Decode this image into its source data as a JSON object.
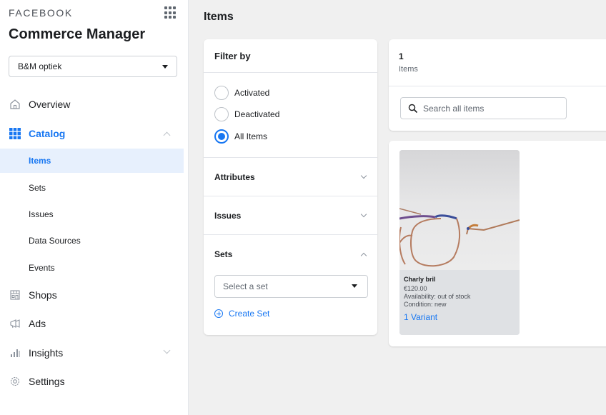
{
  "sidebar": {
    "brand": "FACEBOOK",
    "app_title": "Commerce Manager",
    "account": "B&M optiek",
    "nav": {
      "overview": "Overview",
      "catalog": "Catalog",
      "shops": "Shops",
      "ads": "Ads",
      "insights": "Insights",
      "settings": "Settings"
    },
    "catalog_sub": [
      "Items",
      "Sets",
      "Issues",
      "Data Sources",
      "Events"
    ]
  },
  "main": {
    "title": "Items",
    "filter": {
      "heading": "Filter by",
      "options": [
        "Activated",
        "Deactivated",
        "All Items"
      ],
      "selected": "All Items",
      "sections": {
        "attributes": "Attributes",
        "issues": "Issues",
        "sets": "Sets"
      },
      "set_placeholder": "Select a set",
      "create_set": "Create Set"
    },
    "summary": {
      "count": "1",
      "count_label": "Items",
      "search_placeholder": "Search all items"
    },
    "products": [
      {
        "name": "Charly bril",
        "price": "€120.00",
        "availability": "Availability: out of stock",
        "condition": "Condition: new",
        "variants": "1 Variant"
      }
    ]
  },
  "colors": {
    "accent": "#1877f2",
    "active_bg": "#e7f0fd",
    "page_bg": "#f0f0f0"
  },
  "icons": [
    "grid-apps-icon",
    "home-icon",
    "catalog-grid-icon",
    "shop-icon",
    "megaphone-icon",
    "bar-chart-icon",
    "gear-icon",
    "search-icon",
    "plus-circle-icon",
    "chevron-icon",
    "caret-down-icon"
  ]
}
